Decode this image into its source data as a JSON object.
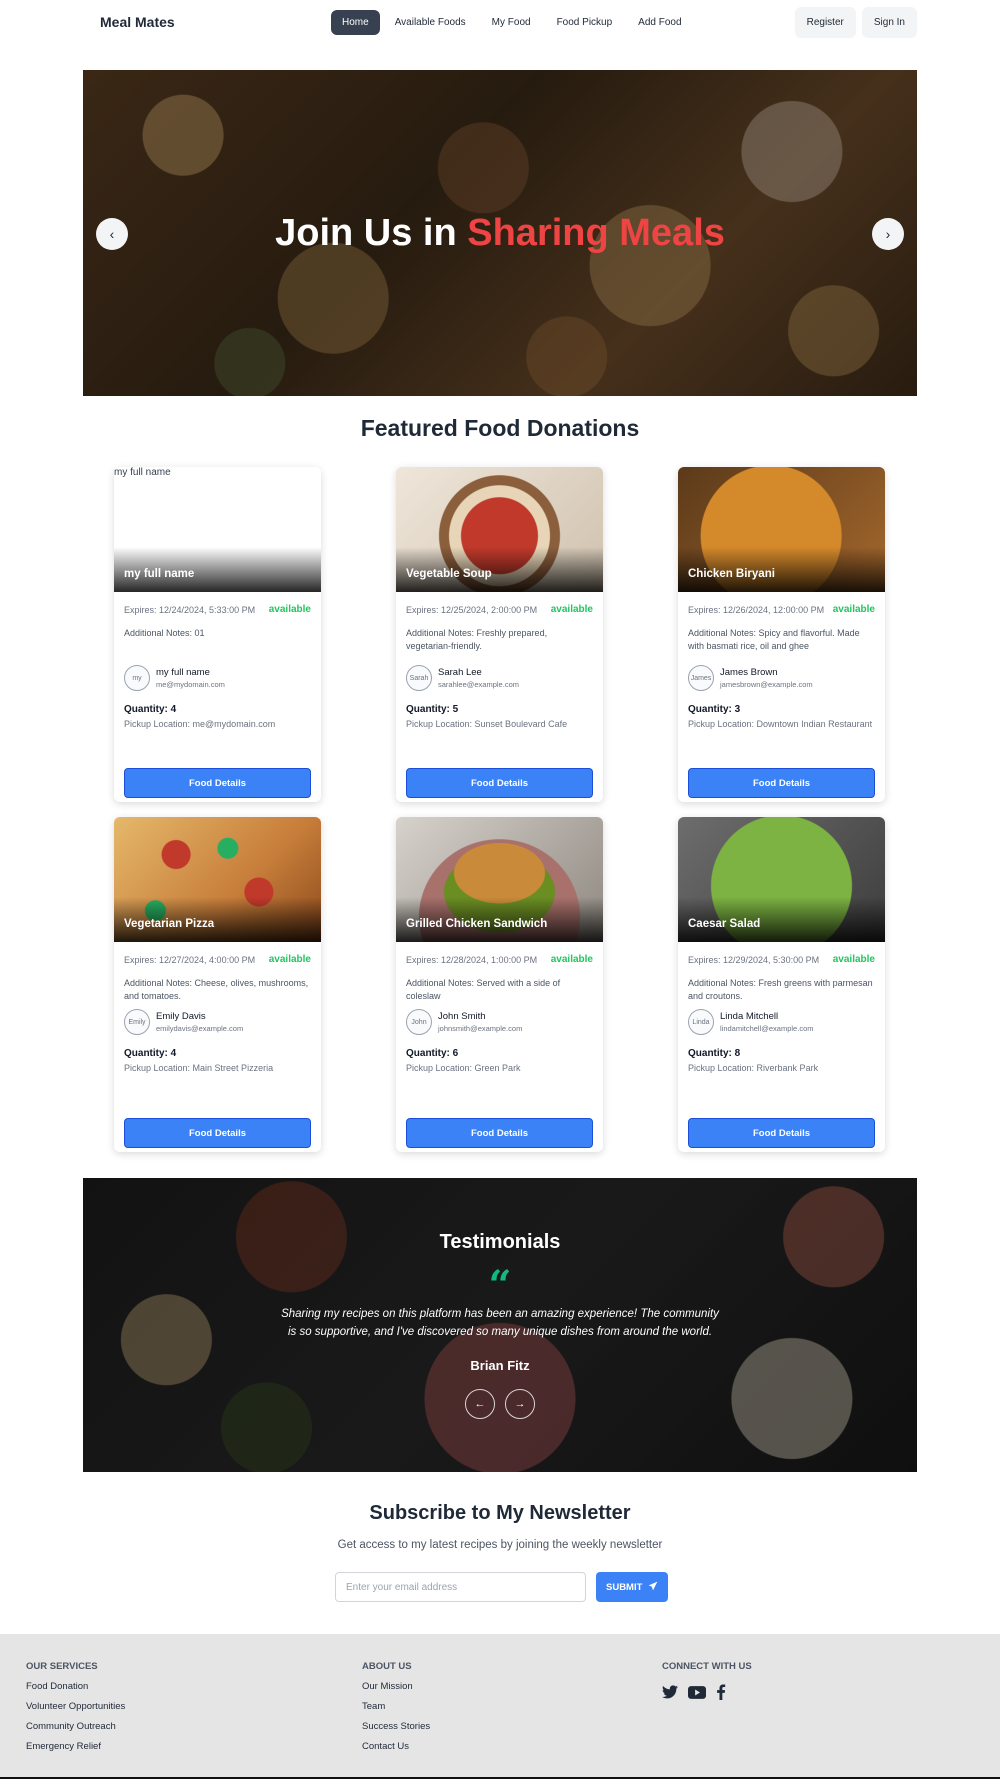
{
  "nav": {
    "brand": "Meal Mates",
    "links": [
      "Home",
      "Available Foods",
      "My Food",
      "Food Pickup",
      "Add Food"
    ],
    "register": "Register",
    "sign_in": "Sign In"
  },
  "hero": {
    "title_part1": "Join Us in ",
    "title_accent": "Sharing Meals",
    "prev": "‹",
    "next": "›"
  },
  "featured": {
    "title": "Featured Food Donations",
    "cards": [
      {
        "name": "my full name",
        "image_alt": "my full name",
        "expires": "Expires: 12/24/2024, 5:33:00 PM",
        "status": "available",
        "notes": "Additional Notes: 01",
        "donor": "my full name",
        "email": "me@mydomain.com",
        "avatar_alt": "my",
        "quantity": "Quantity: 4",
        "pickup": "Pickup Location: me@mydomain.com",
        "button": "Food Details"
      },
      {
        "name": "Vegetable Soup",
        "image_alt": "",
        "expires": "Expires: 12/25/2024, 2:00:00 PM",
        "status": "available",
        "notes": "Additional Notes: Freshly prepared, vegetarian-friendly.",
        "donor": "Sarah Lee",
        "email": "sarahlee@example.com",
        "avatar_alt": "Sarah",
        "quantity": "Quantity: 5",
        "pickup": "Pickup Location: Sunset Boulevard Cafe",
        "button": "Food Details"
      },
      {
        "name": "Chicken Biryani",
        "image_alt": "",
        "expires": "Expires: 12/26/2024, 12:00:00 PM",
        "status": "available",
        "notes": "Additional Notes: Spicy and flavorful. Made with basmati rice, oil and ghee",
        "donor": "James Brown",
        "email": "jamesbrown@example.com",
        "avatar_alt": "James",
        "quantity": "Quantity: 3",
        "pickup": "Pickup Location: Downtown Indian Restaurant",
        "button": "Food Details"
      },
      {
        "name": "Vegetarian Pizza",
        "image_alt": "",
        "expires": "Expires: 12/27/2024, 4:00:00 PM",
        "status": "available",
        "notes": "Additional Notes: Cheese, olives, mushrooms, and tomatoes.",
        "donor": "Emily Davis",
        "email": "emilydavis@example.com",
        "avatar_alt": "Emily",
        "quantity": "Quantity: 4",
        "pickup": "Pickup Location: Main Street Pizzeria",
        "button": "Food Details"
      },
      {
        "name": "Grilled Chicken Sandwich",
        "image_alt": "",
        "expires": "Expires: 12/28/2024, 1:00:00 PM",
        "status": "available",
        "notes": "Additional Notes: Served with a side of coleslaw",
        "donor": "John Smith",
        "email": "johnsmith@example.com",
        "avatar_alt": "John",
        "quantity": "Quantity: 6",
        "pickup": "Pickup Location: Green Park",
        "button": "Food Details"
      },
      {
        "name": "Caesar Salad",
        "image_alt": "",
        "expires": "Expires: 12/29/2024, 5:30:00 PM",
        "status": "available",
        "notes": "Additional Notes: Fresh greens with parmesan and croutons.",
        "donor": "Linda Mitchell",
        "email": "lindamitchell@example.com",
        "avatar_alt": "Linda",
        "quantity": "Quantity: 8",
        "pickup": "Pickup Location: Riverbank Park",
        "button": "Food Details"
      }
    ]
  },
  "testimonials": {
    "title": "Testimonials",
    "quote": "Sharing my recipes on this platform has been an amazing experience! The community is so supportive, and I've discovered so many unique dishes from around the world.",
    "author": "Brian Fitz",
    "prev": "←",
    "next": "→"
  },
  "newsletter": {
    "title": "Subscribe to My Newsletter",
    "subtitle": "Get access to my latest recipes by joining the weekly newsletter",
    "placeholder": "Enter your email address",
    "submit": "SUBMIT"
  },
  "footer": {
    "services": {
      "heading": "OUR SERVICES",
      "items": [
        "Food Donation",
        "Volunteer Opportunities",
        "Community Outreach",
        "Emergency Relief"
      ]
    },
    "about": {
      "heading": "ABOUT US",
      "items": [
        "Our Mission",
        "Team",
        "Success Stories",
        "Contact Us"
      ]
    },
    "connect": {
      "heading": "CONNECT WITH US",
      "icons": [
        "twitter-icon",
        "youtube-icon",
        "facebook-icon"
      ]
    }
  },
  "colors": {
    "accent": "#ef4444",
    "primary": "#3b82f6",
    "available": "#22c55e",
    "quote": "#10b981"
  }
}
